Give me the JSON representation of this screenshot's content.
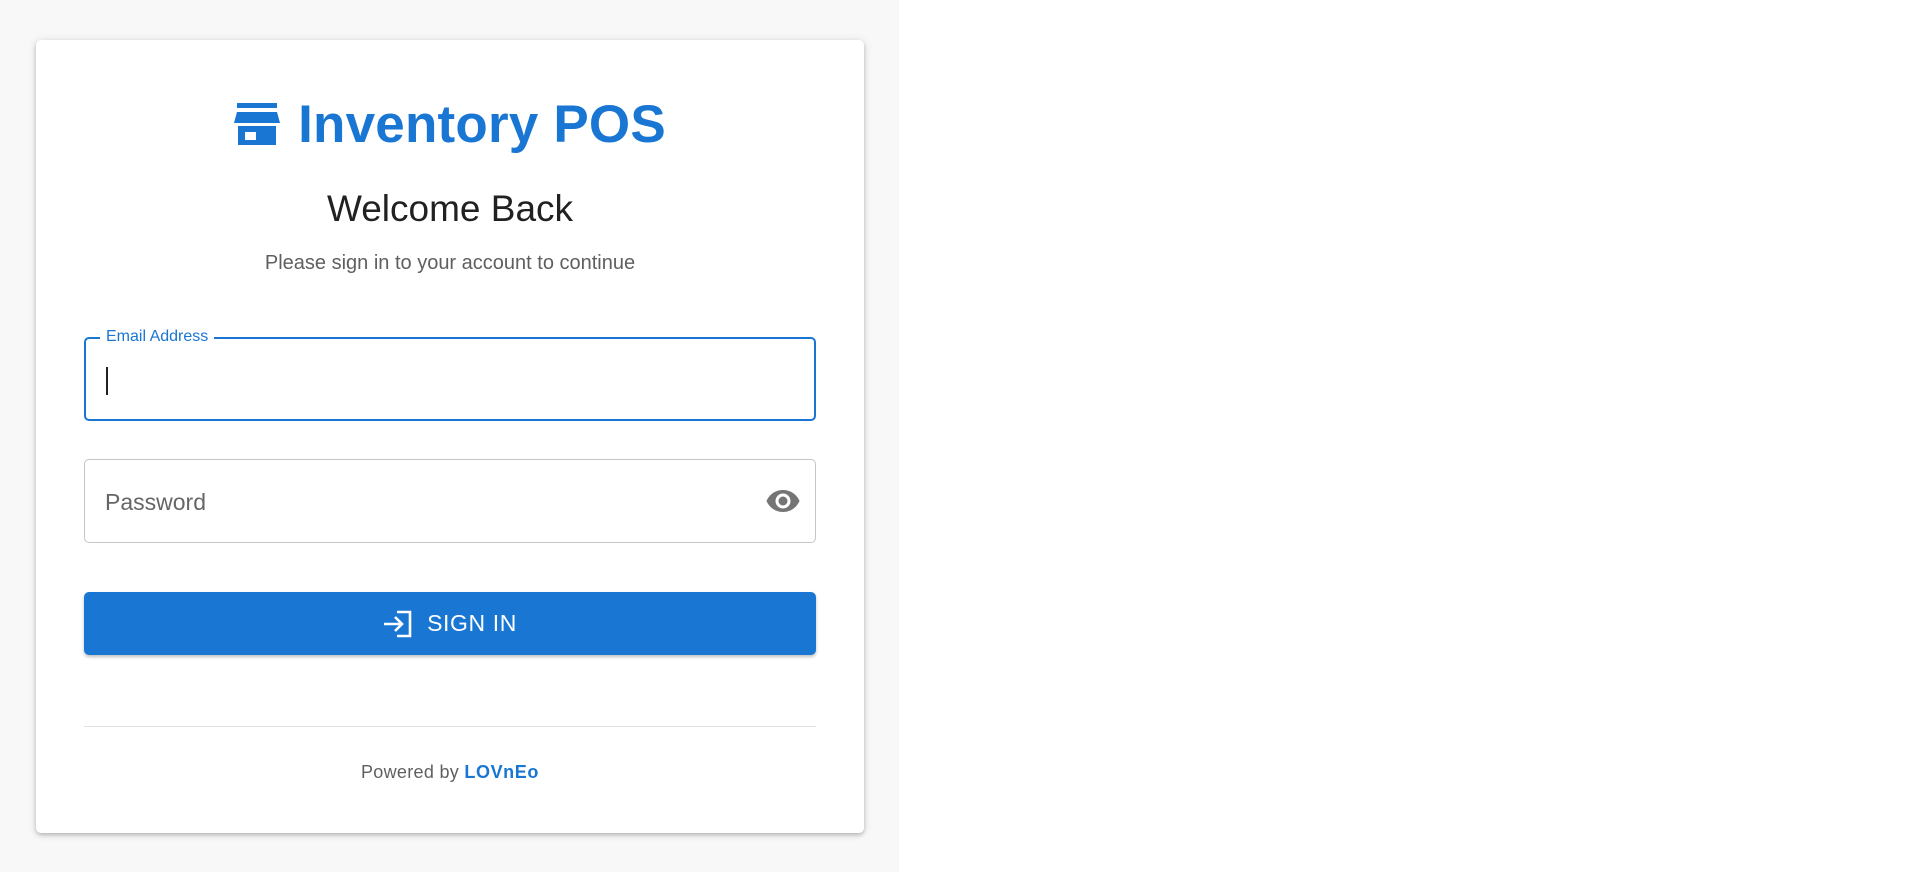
{
  "app": {
    "title": "Inventory POS",
    "icon": "storefront-icon",
    "brand_color": "#1976d2"
  },
  "login": {
    "heading": "Welcome Back",
    "subtitle": "Please sign in to your account to continue",
    "email": {
      "label": "Email Address",
      "value": ""
    },
    "password": {
      "placeholder": "Password",
      "value": "",
      "toggle_icon": "eye-icon"
    },
    "submit": {
      "label": "SIGN IN",
      "icon": "login-icon"
    }
  },
  "footer": {
    "prefix": "Powered by",
    "brand": "LOVnEo"
  }
}
